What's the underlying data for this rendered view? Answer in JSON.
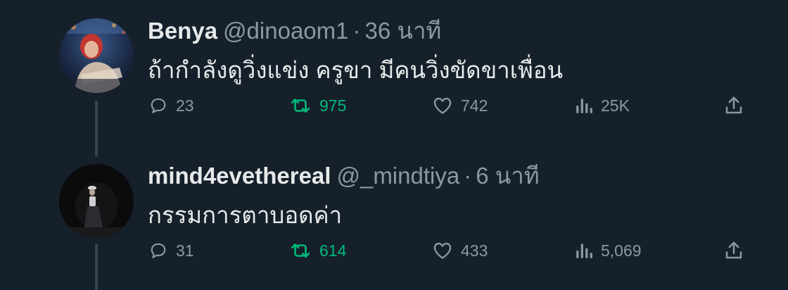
{
  "tweets": [
    {
      "display_name": "Benya",
      "handle": "@dinoaom1",
      "separator": "·",
      "time": "36 นาที",
      "text": "ถ้ากำลังดูวิ่งแข่ง ครูขา มีคนวิ่งขัดขาเพื่อน",
      "replies": "23",
      "retweets": "975",
      "likes": "742",
      "views": "25K",
      "retweeted": true
    },
    {
      "display_name": "mind4evethereal",
      "handle": "@_mindtiya",
      "separator": "·",
      "time": "6 นาที",
      "text": "กรรมการตาบอดค่า",
      "replies": "31",
      "retweets": "614",
      "likes": "433",
      "views": "5,069",
      "retweeted": true
    }
  ],
  "colors": {
    "background": "#15202b",
    "text_primary": "#e7e9ea",
    "text_secondary": "#8b98a5",
    "retweet_active": "#00ba7c",
    "thread_line": "#38444d"
  },
  "icons": {
    "reply": "reply-icon",
    "retweet": "retweet-icon",
    "like": "heart-icon",
    "views": "views-icon",
    "share": "share-icon"
  }
}
